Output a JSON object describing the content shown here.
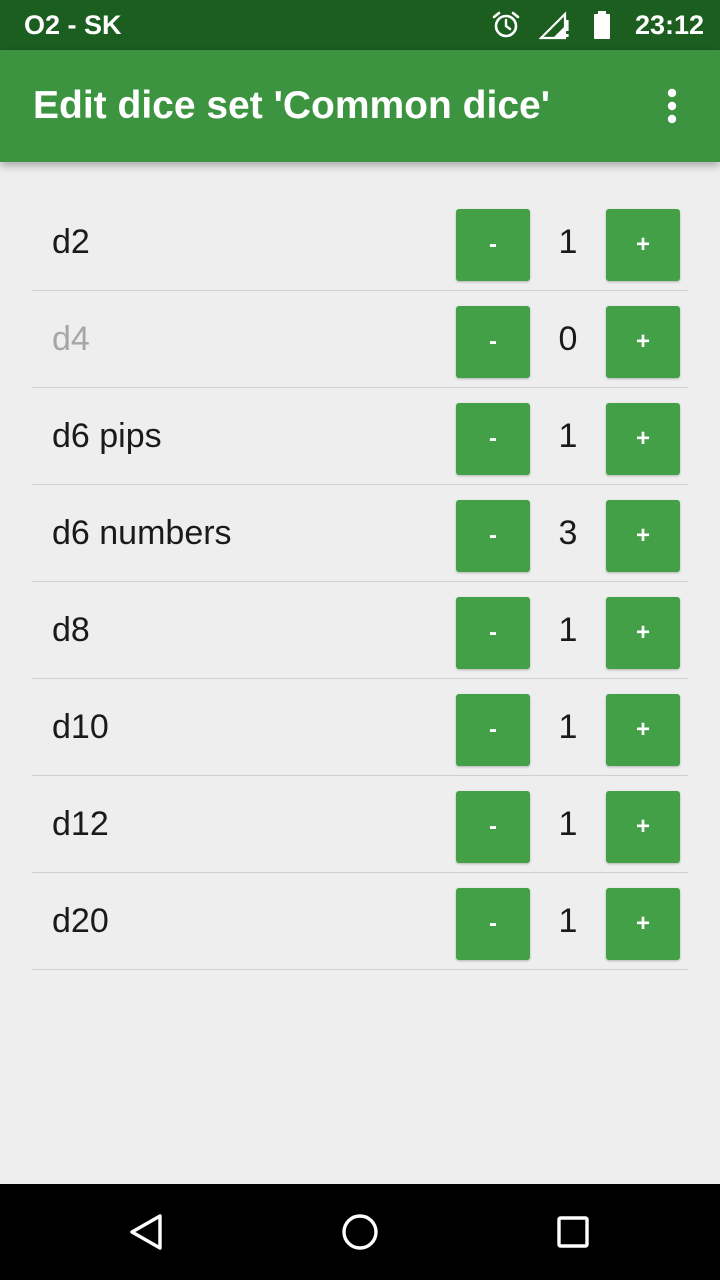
{
  "status_bar": {
    "carrier": "O2 - SK",
    "time": "23:12",
    "icons": [
      "alarm-icon",
      "signal-icon",
      "battery-icon"
    ]
  },
  "app_bar": {
    "title": "Edit dice set 'Common dice'",
    "menu_icon": "more-vert-icon"
  },
  "dice": [
    {
      "name": "d2",
      "count": "1",
      "minus_label": "-",
      "plus_label": "+",
      "disabled": false
    },
    {
      "name": "d4",
      "count": "0",
      "minus_label": "-",
      "plus_label": "+",
      "disabled": true
    },
    {
      "name": "d6 pips",
      "count": "1",
      "minus_label": "-",
      "plus_label": "+",
      "disabled": false
    },
    {
      "name": "d6 numbers",
      "count": "3",
      "minus_label": "-",
      "plus_label": "+",
      "disabled": false
    },
    {
      "name": "d8",
      "count": "1",
      "minus_label": "-",
      "plus_label": "+",
      "disabled": false
    },
    {
      "name": "d10",
      "count": "1",
      "minus_label": "-",
      "plus_label": "+",
      "disabled": false
    },
    {
      "name": "d12",
      "count": "1",
      "minus_label": "-",
      "plus_label": "+",
      "disabled": false
    },
    {
      "name": "d20",
      "count": "1",
      "minus_label": "-",
      "plus_label": "+",
      "disabled": false
    }
  ],
  "nav_bar": {
    "icons": [
      "back-icon",
      "home-icon",
      "recents-icon"
    ]
  },
  "colors": {
    "status_bar": "#1b5e20",
    "app_bar": "#3c9440",
    "button": "#43a047",
    "background": "#eeeeee",
    "disabled_text": "#a6a6a6"
  }
}
